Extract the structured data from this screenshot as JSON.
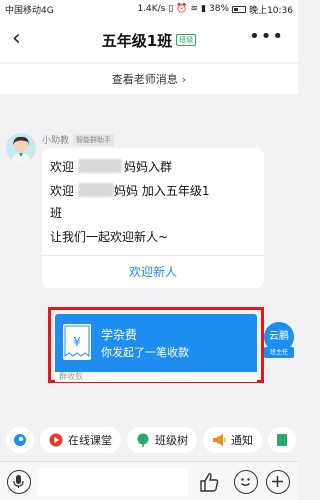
{
  "status_bar": {
    "carrier": "中国移动4G",
    "speed": "1.4K/s",
    "battery": "38%",
    "time": "晚上10:36"
  },
  "nav": {
    "title": "五年级1班",
    "tag": "班级"
  },
  "teacher_banner": {
    "label": "查看老师消息",
    "chevron": "›"
  },
  "assistant_message": {
    "sender": "小助教",
    "sender_tag": "智能群助手",
    "line1_start": "欢迎",
    "line1_end": "妈妈入群",
    "line2_start": "欢迎",
    "line2_end": "妈妈 加入五年级1",
    "line3": "班",
    "line4": "让我们一起欢迎新人~",
    "action": "欢迎新人"
  },
  "fee_card": {
    "title": "学杂费",
    "subtitle": "你发起了一笔收款",
    "footer": "群收款"
  },
  "teacher": {
    "name": "云鹏",
    "role": "班主任"
  },
  "shortcuts": [
    {
      "label": "在线课堂",
      "icon": "play-icon",
      "color": "#e33a2f"
    },
    {
      "label": "班级树",
      "icon": "tree-icon",
      "color": "#2aa96b"
    },
    {
      "label": "通知",
      "icon": "megaphone-icon",
      "color": "#f08c1a"
    }
  ],
  "input": {
    "placeholder": ""
  },
  "colors": {
    "accent": "#1e8ef0",
    "highlight": "#e01818",
    "link": "#2b88e6"
  }
}
